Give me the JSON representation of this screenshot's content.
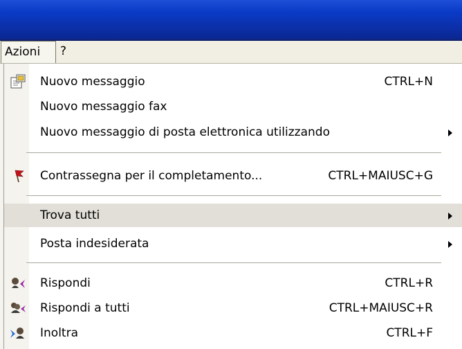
{
  "menubar": {
    "azioni": "Azioni",
    "help": "?"
  },
  "menu": {
    "items": [
      {
        "label": "Nuovo messaggio",
        "shortcut": "CTRL+N",
        "icon": "new-message-icon"
      },
      {
        "label": "Nuovo messaggio fax",
        "shortcut": ""
      },
      {
        "label": "Nuovo messaggio di posta elettronica utilizzando",
        "submenu": true
      },
      {
        "label": "Contrassegna per il completamento...",
        "shortcut": "CTRL+MAIUSC+G",
        "icon": "flag-icon"
      },
      {
        "label": "Trova tutti",
        "submenu": true,
        "highlighted": true
      },
      {
        "label": "Posta indesiderata",
        "submenu": true
      },
      {
        "label": "Rispondi",
        "shortcut": "CTRL+R",
        "icon": "reply-icon"
      },
      {
        "label": "Rispondi a tutti",
        "shortcut": "CTRL+MAIUSC+R",
        "icon": "reply-all-icon"
      },
      {
        "label": "Inoltra",
        "shortcut": "CTRL+F",
        "icon": "forward-icon"
      }
    ]
  },
  "colors": {
    "titlebar": "#0a3bc7",
    "menubar": "#f1efe4",
    "highlight": "#e1dfd8",
    "flag": "#c0121a",
    "reply_arrow": "#9b2aa6",
    "forward_arrow": "#2a6fd6"
  }
}
